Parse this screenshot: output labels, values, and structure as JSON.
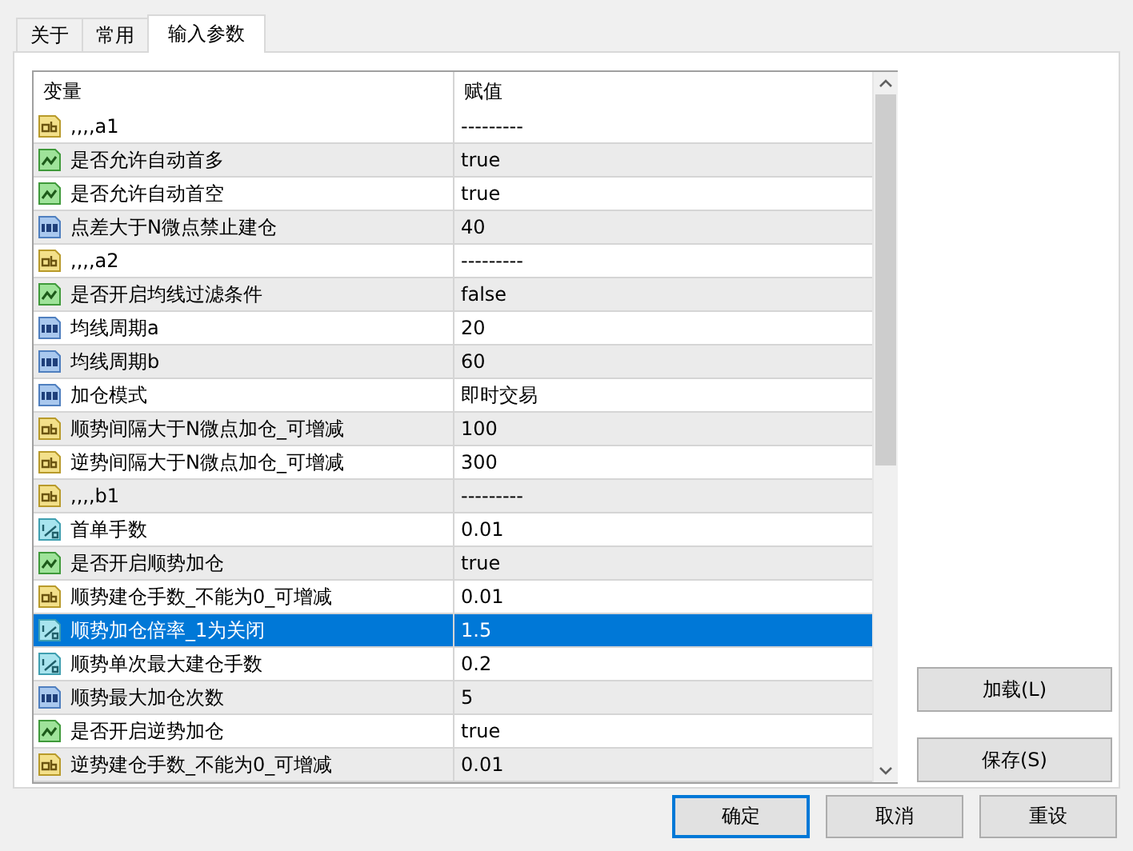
{
  "tabs": [
    {
      "label": "关于",
      "selected": false
    },
    {
      "label": "常用",
      "selected": false
    },
    {
      "label": "输入参数",
      "selected": true
    }
  ],
  "table": {
    "columns": [
      "变量",
      "赋值"
    ],
    "rows": [
      {
        "kind": "string",
        "name": ",,,,a1",
        "value": "---------",
        "selected": false
      },
      {
        "kind": "bool",
        "name": "是否允许自动首多",
        "value": "true",
        "selected": false
      },
      {
        "kind": "bool",
        "name": "是否允许自动首空",
        "value": "true",
        "selected": false
      },
      {
        "kind": "int",
        "name": "点差大于N微点禁止建仓",
        "value": "40",
        "selected": false
      },
      {
        "kind": "string",
        "name": ",,,,a2",
        "value": "---------",
        "selected": false
      },
      {
        "kind": "bool",
        "name": "是否开启均线过滤条件",
        "value": "false",
        "selected": false
      },
      {
        "kind": "int",
        "name": "均线周期a",
        "value": "20",
        "selected": false
      },
      {
        "kind": "int",
        "name": "均线周期b",
        "value": "60",
        "selected": false
      },
      {
        "kind": "int",
        "name": "加仓模式",
        "value": "即时交易",
        "selected": false
      },
      {
        "kind": "string",
        "name": "顺势间隔大于N微点加仓_可增减",
        "value": "100",
        "selected": false
      },
      {
        "kind": "string",
        "name": "逆势间隔大于N微点加仓_可增减",
        "value": "300",
        "selected": false
      },
      {
        "kind": "string",
        "name": ",,,,b1",
        "value": "---------",
        "selected": false
      },
      {
        "kind": "double",
        "name": "首单手数",
        "value": "0.01",
        "selected": false
      },
      {
        "kind": "bool",
        "name": "是否开启顺势加仓",
        "value": "true",
        "selected": false
      },
      {
        "kind": "string",
        "name": "顺势建仓手数_不能为0_可增减",
        "value": "0.01",
        "selected": false
      },
      {
        "kind": "double",
        "name": "顺势加仓倍率_1为关闭",
        "value": "1.5",
        "selected": true
      },
      {
        "kind": "double",
        "name": "顺势单次最大建仓手数",
        "value": "0.2",
        "selected": false
      },
      {
        "kind": "int",
        "name": "顺势最大加仓次数",
        "value": "5",
        "selected": false
      },
      {
        "kind": "bool",
        "name": "是否开启逆势加仓",
        "value": "true",
        "selected": false
      },
      {
        "kind": "string",
        "name": "逆势建仓手数_不能为0_可增减",
        "value": "0.01",
        "selected": false
      }
    ]
  },
  "side_buttons": [
    "加载(L)",
    "保存(S)"
  ],
  "buttons": [
    {
      "label": "确定",
      "default": true
    },
    {
      "label": "取消",
      "default": false
    },
    {
      "label": "重设",
      "default": false
    }
  ]
}
